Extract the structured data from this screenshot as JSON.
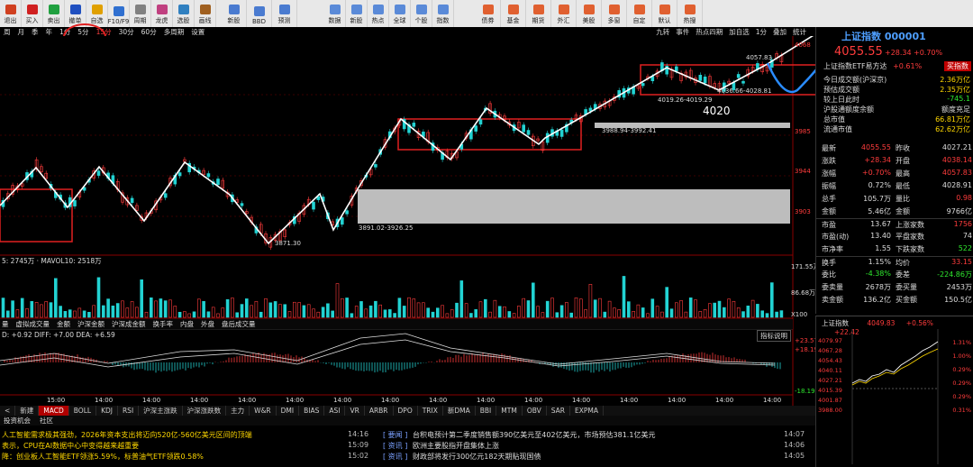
{
  "toolbar": {
    "buttons": [
      {
        "label": "退出",
        "icon": "exit-icon"
      },
      {
        "label": "买入",
        "icon": "buy-icon"
      },
      {
        "label": "卖出",
        "icon": "sell-icon"
      },
      {
        "label": "撤单",
        "icon": "cancel-order-icon"
      },
      {
        "label": "自选",
        "icon": "star-icon"
      },
      {
        "label": "F10/F9",
        "icon": "f10-icon"
      },
      {
        "label": "周期",
        "icon": "period-icon"
      },
      {
        "label": "龙虎",
        "icon": "dragon-tiger-icon"
      },
      {
        "label": "选股",
        "icon": "stock-pick-icon"
      },
      {
        "label": "画线",
        "icon": "draw-line-icon"
      }
    ],
    "buttons2": [
      "新股",
      "BBD",
      "预测"
    ],
    "buttons3": [
      "数据",
      "新股",
      "热点",
      "全球",
      "个股",
      "指数"
    ],
    "buttons4": [
      "债券",
      "基金",
      "期货",
      "外汇",
      "美股",
      "多窗",
      "自定",
      "默认",
      "热搜"
    ]
  },
  "periods": [
    "周",
    "月",
    "季",
    "年",
    "1分",
    "5分",
    "15分",
    "30分",
    "60分",
    "多周期",
    "设置"
  ],
  "active_period": "15分",
  "period_right": [
    "九转",
    "事件",
    "热点四期",
    "加自选",
    "1分",
    "叠加",
    "统计"
  ],
  "chart": {
    "price_labels": [
      "4068",
      "3985",
      "3944",
      "3903"
    ],
    "annotations": [
      "4057.83",
      "4019.26-4019.29",
      "4036.66-4028.81",
      "4020",
      "3988.94-3992.41",
      "3891.02-3926.25",
      "3871.30"
    ],
    "volume_legend": "5: 2745万 · MAVOL10: 2518万",
    "volume_labels": [
      "171.55万",
      "86.68万",
      "X100"
    ],
    "sub_tabs": [
      "量",
      "虚拟成交量",
      "金额",
      "沪深金额",
      "沪深成金额",
      "换手率",
      "内盘",
      "外盘",
      "盘后成交量"
    ],
    "macd_legend": "D: +0.92   DIFF: +7.00   DEA: +6.59",
    "macd_labels": [
      "+23.57",
      "+18.19",
      "-18.19"
    ],
    "macd_btn": "指标说明",
    "time_labels": [
      "15:00",
      "14:00",
      "14:00",
      "14:00",
      "14:00",
      "14:00",
      "14:00",
      "14:00",
      "14:00",
      "14:00",
      "14:00",
      "14:00",
      "14:00",
      "14:00",
      "14:00",
      "14:00"
    ]
  },
  "rpanel": {
    "title": "上证指数 000001",
    "price": "4055.55",
    "change": "+28.34",
    "change_pct": "+0.70%",
    "etf_label": "上证指数ETF易方达",
    "etf_pct": "+0.61%",
    "etf_btn": "买指数",
    "info": [
      {
        "k": "今日成交额(沪深京)",
        "v": "2.36万亿"
      },
      {
        "k": "预估成交额",
        "v": "2.35万亿"
      },
      {
        "k": "较上日此时",
        "v": "-745.1"
      },
      {
        "k": "沪股通额度余额",
        "v": "额度充足"
      },
      {
        "k": "总市值",
        "v": "66.81万亿"
      },
      {
        "k": "流通市值",
        "v": "62.62万亿"
      }
    ],
    "grid": [
      [
        "最新",
        "4055.55",
        "昨收",
        "4027.21"
      ],
      [
        "涨跌",
        "+28.34",
        "开盘",
        "4038.14"
      ],
      [
        "涨幅",
        "+0.70%",
        "最高",
        "4057.83"
      ],
      [
        "振幅",
        "0.72%",
        "最低",
        "4028.91"
      ],
      [
        "总手",
        "105.7万",
        "量比",
        "0.98"
      ],
      [
        "金额",
        "5.46亿",
        "金额",
        "9766亿"
      ],
      [
        "市盈",
        "13.67",
        "上涨家数",
        "1756"
      ],
      [
        "市盈(动)",
        "13.40",
        "平盘家数",
        "74"
      ],
      [
        "市净率",
        "1.55",
        "下跌家数",
        "522"
      ],
      [
        "换手",
        "1.15%",
        "均价",
        "33.15"
      ],
      [
        "委比",
        "-4.38%",
        "委差",
        "-224.86万"
      ],
      [
        "委卖量",
        "2678万",
        "委买量",
        "2453万"
      ],
      [
        "卖金额",
        "136.2亿",
        "买金额",
        "150.5亿"
      ]
    ],
    "mini_title": "上证指数",
    "mini_price": "4049.83",
    "mini_pct": "+0.56%",
    "mini_chg": "+22.42",
    "mini_axis": [
      "4079.97",
      "4067.28",
      "4054.43",
      "4040.11",
      "4027.21",
      "4015.39",
      "4001.87",
      "3988.00"
    ],
    "mini_pct_axis": [
      "1.31%",
      "1.00%",
      "0.29%",
      "0.29%",
      "0.29%",
      "0.31%"
    ]
  },
  "bottom_tabs": [
    "<",
    "新建",
    "MACD",
    "BOLL",
    "KDJ",
    "RSI",
    "沪深主涨跌",
    "沪深涨跌数",
    "主力",
    "W&R",
    "DMI",
    "BIAS",
    "ASI",
    "VR",
    "ARBR",
    "DPO",
    "TRIX",
    "新DMA",
    "BBI",
    "MTM",
    "OBV",
    "SAR",
    "EXPMA"
  ],
  "active_bottom_tab": "MACD",
  "sub_bottom_tabs": [
    "投资机会",
    "社区"
  ],
  "news": [
    {
      "text": "人工智能需求极其强劲，2026年资本支出将迈向520亿-560亿美元区间的顶端"
    },
    {
      "text": "表示，CPU在AI数据中心中变得越来越重要"
    },
    {
      "text": "降：创业板人工智能ETF领涨5.59%，标普油气ETF领跌0.58%"
    }
  ],
  "news_right": [
    {
      "time": "14:16",
      "tag": "要闻",
      "text": "台积电预计第二季度销售额390亿美元至402亿美元，市场预估381.1亿美元",
      "time2": "14:07"
    },
    {
      "time": "15:09",
      "tag": "资讯",
      "text": "欧洲主要股指开盘集体上涨",
      "time2": "14:06"
    },
    {
      "time": "15:02",
      "tag": "资讯",
      "text": "财政部将发行300亿元182天期贴现国债",
      "time2": "14:05"
    }
  ]
}
